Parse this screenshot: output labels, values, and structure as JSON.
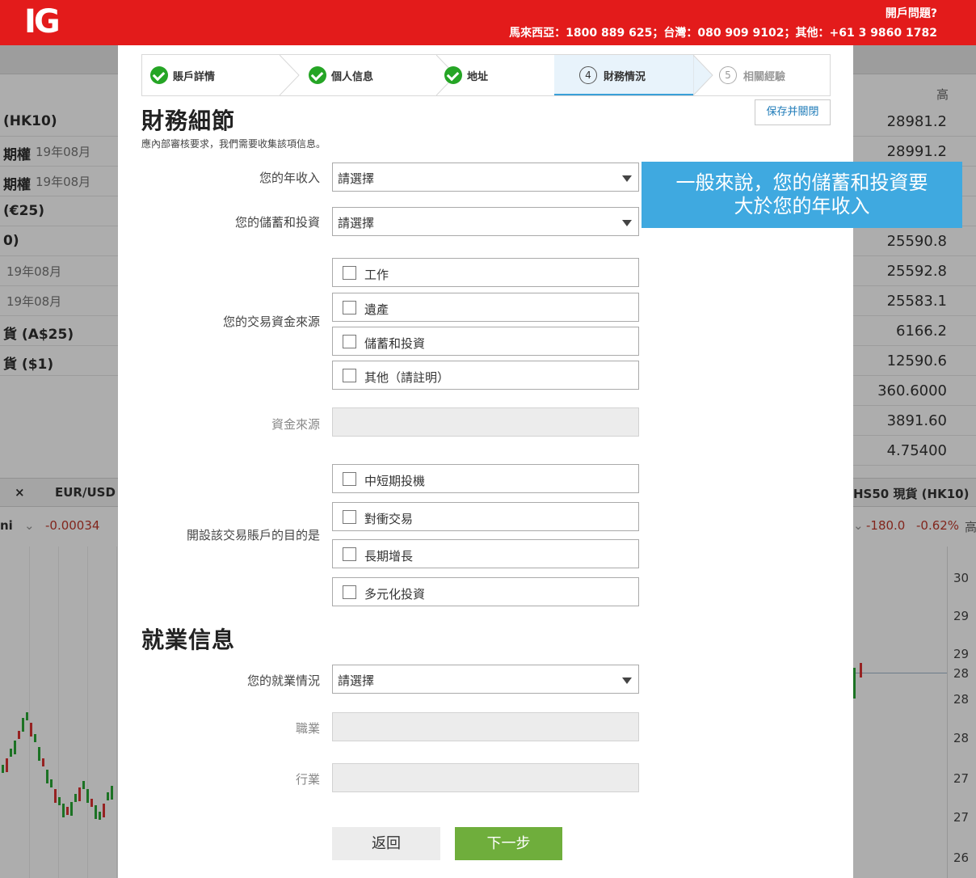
{
  "header": {
    "logo": "IG",
    "help_link": "開戶問題?",
    "phones": "馬來西亞：1800 889 625；台灣：080 909 9102；其他：+61 3 9860 1782"
  },
  "background": {
    "left_rows": [
      {
        "label": "(HK10)",
        "date": ""
      },
      {
        "label": "期權",
        "date": "19年08月"
      },
      {
        "label": "期權",
        "date": "19年08月"
      },
      {
        "label": "(€25)",
        "date": ""
      },
      {
        "label": "0)",
        "date": ""
      },
      {
        "label": "",
        "date": "19年08月"
      },
      {
        "label": "",
        "date": "19年08月"
      },
      {
        "label": "貨 (A$25)",
        "date": ""
      },
      {
        "label": "貨 ($1)",
        "date": ""
      }
    ],
    "right_header": "高",
    "right_values": [
      "28981.2",
      "28991.2",
      "",
      "",
      "25590.8",
      "25592.8",
      "25583.1",
      "6166.2",
      "12590.6",
      "360.6000",
      "3891.60",
      "4.75400"
    ],
    "tab_left_close": "×",
    "tab_left_label": "EUR/USD",
    "tab_right_label": "HS50 現貨 (HK10)",
    "left_sub_label": "ni",
    "left_sub_change": "-0.00034",
    "right_sub_change": "-180.0",
    "right_sub_pct": "-0.62%",
    "right_sub_tail": "高",
    "axis_labels": [
      "30",
      "29",
      "29",
      "28",
      "28",
      "28",
      "27",
      "27",
      "26"
    ]
  },
  "steps": [
    {
      "label": "賬戶詳情",
      "state": "done"
    },
    {
      "label": "個人信息",
      "state": "done"
    },
    {
      "label": "地址",
      "state": "done"
    },
    {
      "label": "財務情況",
      "state": "active",
      "number": "4"
    },
    {
      "label": "相關經驗",
      "state": "upcoming",
      "number": "5"
    }
  ],
  "save_close_label": "保存并關閉",
  "section_financial": {
    "title": "財務細節",
    "subtitle": "應內部審核要求，我們需要收集該項信息。",
    "annual_income": {
      "label": "您的年收入",
      "value": "請選擇"
    },
    "savings": {
      "label": "您的儲蓄和投資",
      "value": "請選擇"
    },
    "funds_source": {
      "label": "您的交易資金來源",
      "options": [
        "工作",
        "遺產",
        "儲蓄和投資",
        "其他（請註明）"
      ]
    },
    "funds_origin": {
      "label": "資金來源",
      "value": ""
    },
    "purpose": {
      "label": "開設該交易賬戶的目的是",
      "options": [
        "中短期投機",
        "對衝交易",
        "長期增長",
        "多元化投資"
      ]
    }
  },
  "section_employment": {
    "title": "就業信息",
    "status": {
      "label": "您的就業情況",
      "value": "請選擇"
    },
    "occupation": {
      "label": "職業",
      "value": ""
    },
    "industry": {
      "label": "行業",
      "value": ""
    }
  },
  "buttons": {
    "back": "返回",
    "next": "下一步"
  },
  "tooltip": {
    "line1": "一般來說，您的儲蓄和投資要",
    "line2": "大於您的年收入"
  },
  "colors": {
    "brand_red": "#e31b1b",
    "success_green": "#25a525",
    "next_button": "#6fae3c",
    "tooltip_blue": "#3fa9e0",
    "link_blue": "#1e7bb8"
  }
}
